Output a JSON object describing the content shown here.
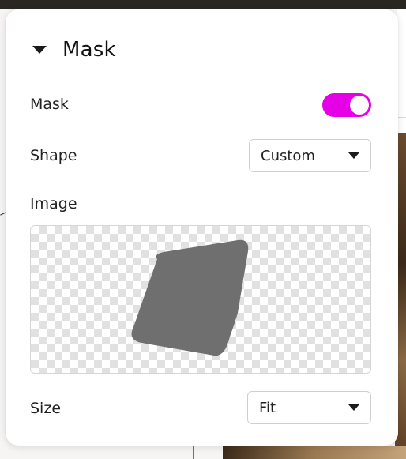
{
  "panel": {
    "title": "Mask",
    "mask_row": {
      "label": "Mask",
      "toggle_on": true,
      "toggle_color": "#e600e6"
    },
    "shape_row": {
      "label": "Shape",
      "value": "Custom"
    },
    "image_row": {
      "label": "Image",
      "preview": "custom-mask-shape"
    },
    "size_row": {
      "label": "Size",
      "value": "Fit"
    }
  },
  "icons": {
    "collapse": "caret-down-icon",
    "dropdown": "chevron-down-icon"
  }
}
